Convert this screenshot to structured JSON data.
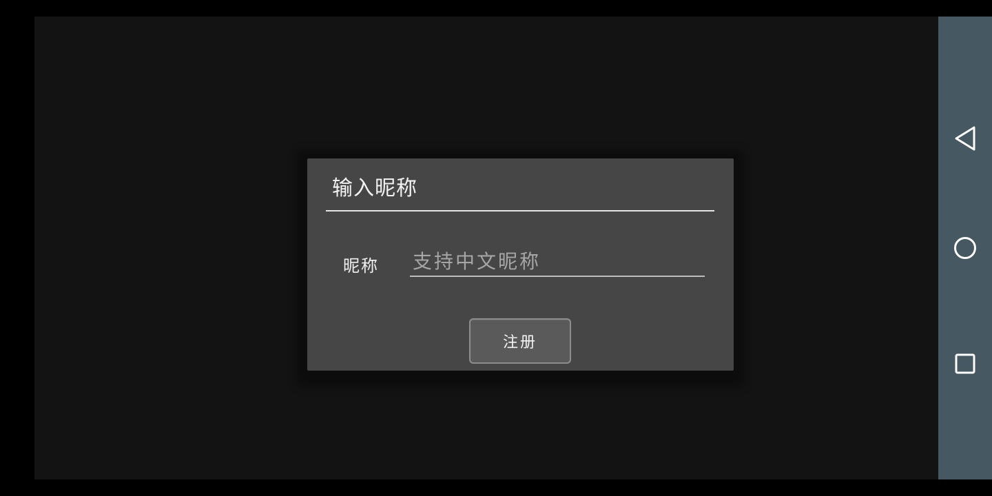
{
  "dialog": {
    "title": "输入昵称",
    "nickname_label": "昵称",
    "nickname_placeholder": "支持中文昵称",
    "nickname_value": "",
    "register_label": "注册"
  },
  "nav_bar": {
    "back_icon": "back-triangle-icon",
    "home_icon": "home-circle-icon",
    "recent_icon": "recent-square-icon"
  },
  "colors": {
    "app_background": "#131313",
    "dialog_background": "#464646",
    "nav_bar_background": "#465862",
    "text": "#f0f0f0",
    "placeholder": "#a6a6a6"
  }
}
